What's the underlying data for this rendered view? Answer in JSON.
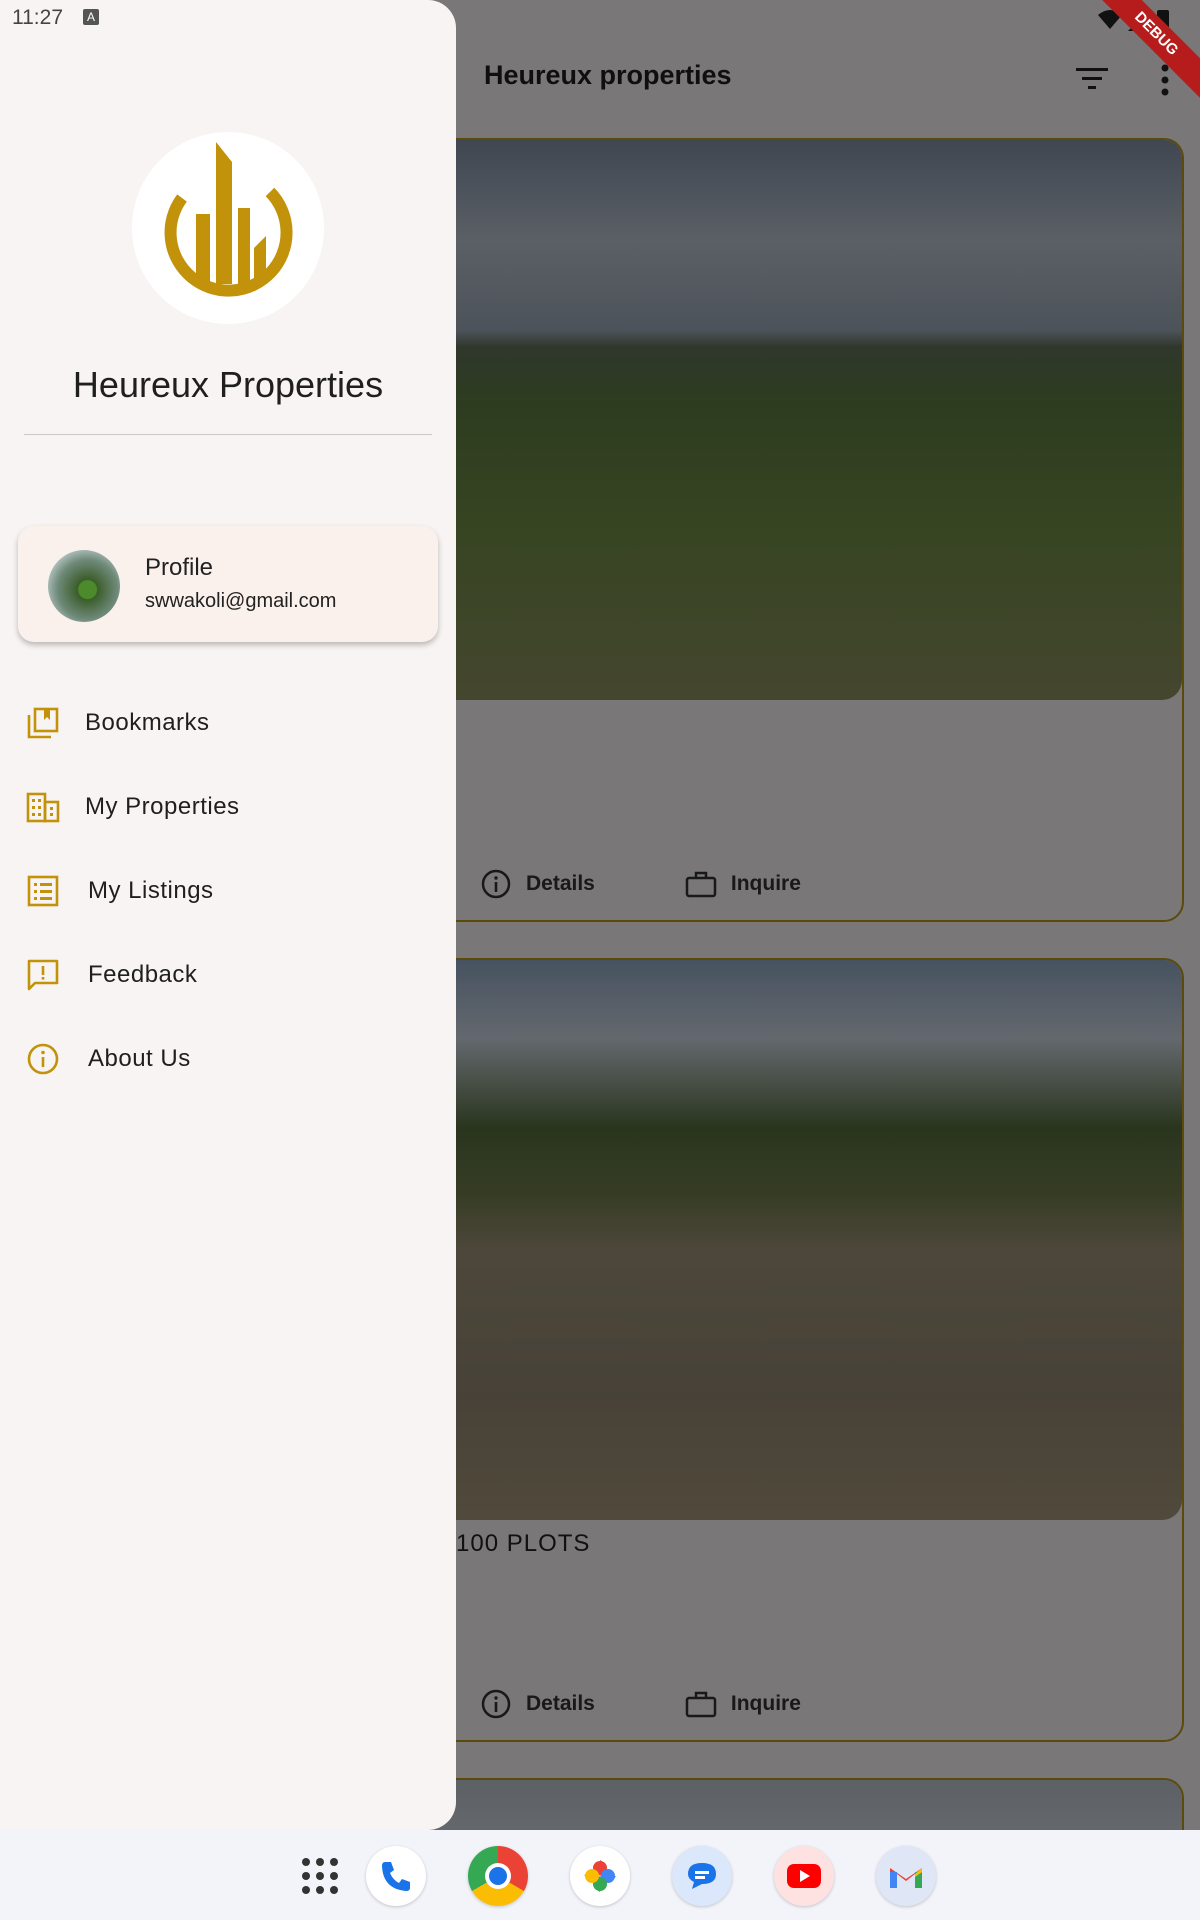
{
  "status_bar": {
    "time": "11:27",
    "notification_badge": "A",
    "debug_banner": "DEBUG"
  },
  "app_bar": {
    "title": "Heureux properties",
    "filter_icon": "filter-icon",
    "more_icon": "more-vertical-icon"
  },
  "listings": [
    {
      "title": "",
      "details_label": "Details",
      "inquire_label": "Inquire"
    },
    {
      "title": "100 PLOTS",
      "details_label": "Details",
      "inquire_label": "Inquire"
    }
  ],
  "drawer": {
    "brand_name": "Heureux Properties",
    "profile": {
      "title": "Profile",
      "email": "swwakoli@gmail.com"
    },
    "items": [
      {
        "label": "Bookmarks",
        "icon": "bookmarks-icon"
      },
      {
        "label": "My Properties",
        "icon": "building-icon"
      },
      {
        "label": "My Listings",
        "icon": "list-icon"
      },
      {
        "label": "Feedback",
        "icon": "feedback-icon"
      },
      {
        "label": "About Us",
        "icon": "info-icon"
      }
    ]
  },
  "dock": [
    "apps-grid-icon",
    "phone-icon",
    "chrome-icon",
    "photos-icon",
    "messages-icon",
    "youtube-icon",
    "gmail-icon"
  ],
  "colors": {
    "accent_gold": "#C2920A",
    "drawer_bg": "#F8F4F3",
    "card_border": "#B8941A",
    "scrim": "rgba(0,0,0,0.5)"
  }
}
